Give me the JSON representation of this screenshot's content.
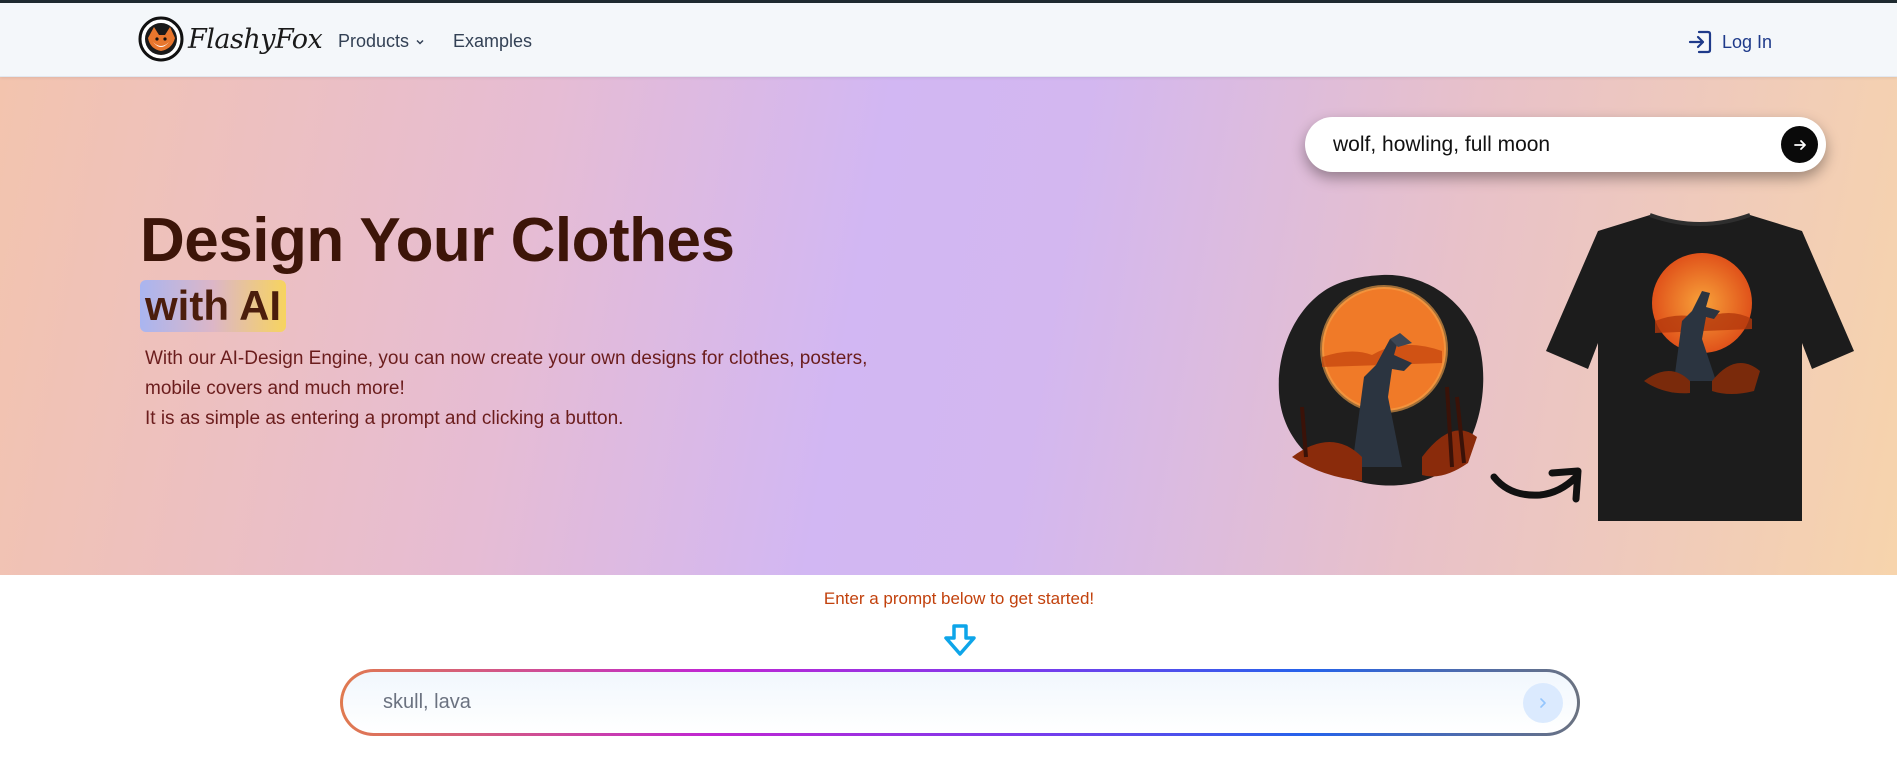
{
  "nav": {
    "brand": "FlashyFox",
    "logo_icon": "fox-logo-icon",
    "products_label": "Products",
    "examples_label": "Examples",
    "login_label": "Log In",
    "login_icon": "log-in-icon"
  },
  "hero": {
    "title": "Design Your Clothes",
    "highlight": "with AI",
    "description": [
      "With our AI-Design Engine, you can now create your own designs for clothes, posters,",
      "mobile covers and much more!",
      "It is as simple as entering a prompt and clicking a button."
    ],
    "example_prompt": "wolf, howling, full moon",
    "example_submit_icon": "arrow-right-icon",
    "illustration": "wolf-howling-moon-sticker",
    "product": "black-tshirt-with-wolf-print"
  },
  "prompt_section": {
    "hint": "Enter a prompt below to get started!",
    "hint_icon": "down-arrow-icon",
    "placeholder": "skull, lava",
    "submit_icon": "chevron-right-icon"
  },
  "colors": {
    "title": "#3d1509",
    "hint": "#c2410c",
    "login": "#1e3a8a",
    "arrow": "#0ea5e9"
  }
}
